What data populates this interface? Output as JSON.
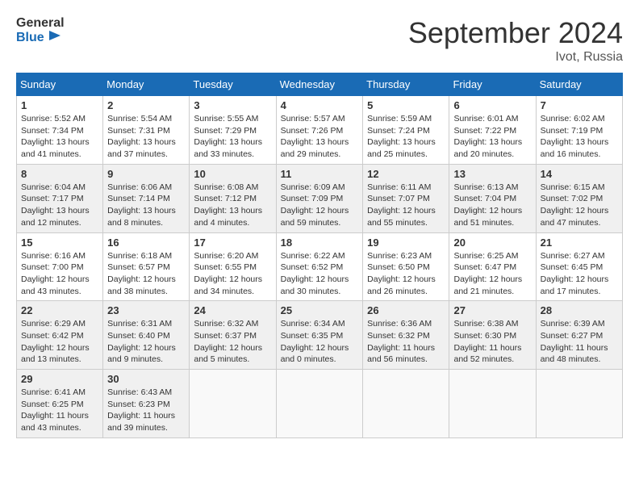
{
  "header": {
    "logo_line1": "General",
    "logo_line2": "Blue",
    "month": "September 2024",
    "location": "Ivot, Russia"
  },
  "weekdays": [
    "Sunday",
    "Monday",
    "Tuesday",
    "Wednesday",
    "Thursday",
    "Friday",
    "Saturday"
  ],
  "weeks": [
    [
      {
        "day": "1",
        "sunrise": "5:52 AM",
        "sunset": "7:34 PM",
        "daylight": "13 hours and 41 minutes."
      },
      {
        "day": "2",
        "sunrise": "5:54 AM",
        "sunset": "7:31 PM",
        "daylight": "13 hours and 37 minutes."
      },
      {
        "day": "3",
        "sunrise": "5:55 AM",
        "sunset": "7:29 PM",
        "daylight": "13 hours and 33 minutes."
      },
      {
        "day": "4",
        "sunrise": "5:57 AM",
        "sunset": "7:26 PM",
        "daylight": "13 hours and 29 minutes."
      },
      {
        "day": "5",
        "sunrise": "5:59 AM",
        "sunset": "7:24 PM",
        "daylight": "13 hours and 25 minutes."
      },
      {
        "day": "6",
        "sunrise": "6:01 AM",
        "sunset": "7:22 PM",
        "daylight": "13 hours and 20 minutes."
      },
      {
        "day": "7",
        "sunrise": "6:02 AM",
        "sunset": "7:19 PM",
        "daylight": "13 hours and 16 minutes."
      }
    ],
    [
      {
        "day": "8",
        "sunrise": "6:04 AM",
        "sunset": "7:17 PM",
        "daylight": "13 hours and 12 minutes."
      },
      {
        "day": "9",
        "sunrise": "6:06 AM",
        "sunset": "7:14 PM",
        "daylight": "13 hours and 8 minutes."
      },
      {
        "day": "10",
        "sunrise": "6:08 AM",
        "sunset": "7:12 PM",
        "daylight": "13 hours and 4 minutes."
      },
      {
        "day": "11",
        "sunrise": "6:09 AM",
        "sunset": "7:09 PM",
        "daylight": "12 hours and 59 minutes."
      },
      {
        "day": "12",
        "sunrise": "6:11 AM",
        "sunset": "7:07 PM",
        "daylight": "12 hours and 55 minutes."
      },
      {
        "day": "13",
        "sunrise": "6:13 AM",
        "sunset": "7:04 PM",
        "daylight": "12 hours and 51 minutes."
      },
      {
        "day": "14",
        "sunrise": "6:15 AM",
        "sunset": "7:02 PM",
        "daylight": "12 hours and 47 minutes."
      }
    ],
    [
      {
        "day": "15",
        "sunrise": "6:16 AM",
        "sunset": "7:00 PM",
        "daylight": "12 hours and 43 minutes."
      },
      {
        "day": "16",
        "sunrise": "6:18 AM",
        "sunset": "6:57 PM",
        "daylight": "12 hours and 38 minutes."
      },
      {
        "day": "17",
        "sunrise": "6:20 AM",
        "sunset": "6:55 PM",
        "daylight": "12 hours and 34 minutes."
      },
      {
        "day": "18",
        "sunrise": "6:22 AM",
        "sunset": "6:52 PM",
        "daylight": "12 hours and 30 minutes."
      },
      {
        "day": "19",
        "sunrise": "6:23 AM",
        "sunset": "6:50 PM",
        "daylight": "12 hours and 26 minutes."
      },
      {
        "day": "20",
        "sunrise": "6:25 AM",
        "sunset": "6:47 PM",
        "daylight": "12 hours and 21 minutes."
      },
      {
        "day": "21",
        "sunrise": "6:27 AM",
        "sunset": "6:45 PM",
        "daylight": "12 hours and 17 minutes."
      }
    ],
    [
      {
        "day": "22",
        "sunrise": "6:29 AM",
        "sunset": "6:42 PM",
        "daylight": "12 hours and 13 minutes."
      },
      {
        "day": "23",
        "sunrise": "6:31 AM",
        "sunset": "6:40 PM",
        "daylight": "12 hours and 9 minutes."
      },
      {
        "day": "24",
        "sunrise": "6:32 AM",
        "sunset": "6:37 PM",
        "daylight": "12 hours and 5 minutes."
      },
      {
        "day": "25",
        "sunrise": "6:34 AM",
        "sunset": "6:35 PM",
        "daylight": "12 hours and 0 minutes."
      },
      {
        "day": "26",
        "sunrise": "6:36 AM",
        "sunset": "6:32 PM",
        "daylight": "11 hours and 56 minutes."
      },
      {
        "day": "27",
        "sunrise": "6:38 AM",
        "sunset": "6:30 PM",
        "daylight": "11 hours and 52 minutes."
      },
      {
        "day": "28",
        "sunrise": "6:39 AM",
        "sunset": "6:27 PM",
        "daylight": "11 hours and 48 minutes."
      }
    ],
    [
      {
        "day": "29",
        "sunrise": "6:41 AM",
        "sunset": "6:25 PM",
        "daylight": "11 hours and 43 minutes."
      },
      {
        "day": "30",
        "sunrise": "6:43 AM",
        "sunset": "6:23 PM",
        "daylight": "11 hours and 39 minutes."
      },
      null,
      null,
      null,
      null,
      null
    ]
  ]
}
